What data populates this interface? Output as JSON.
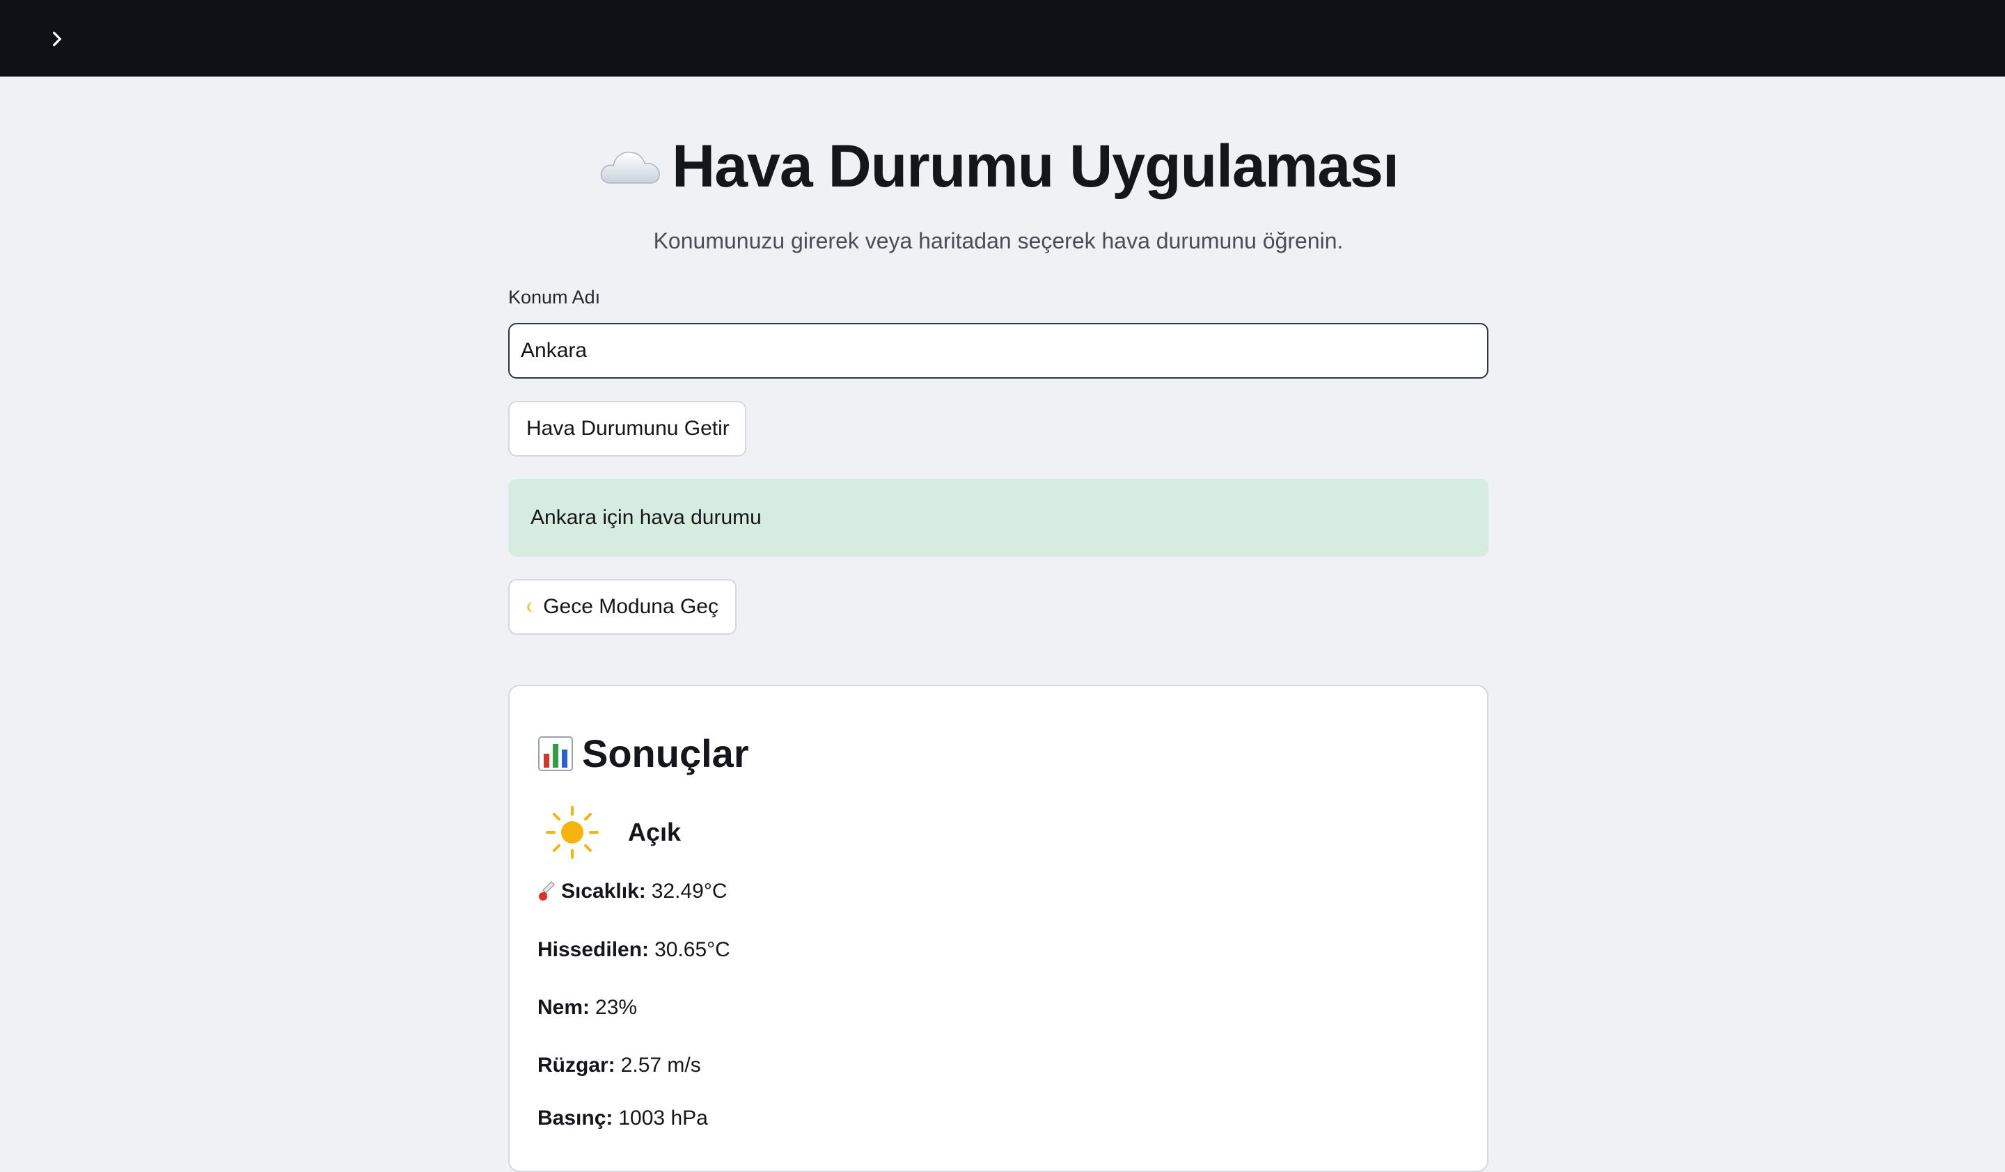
{
  "header": {
    "sidebar_toggle_icon": "chevron-right-icon"
  },
  "page": {
    "title_icon": "cloud-icon",
    "title": "Hava Durumu Uygulaması",
    "subtitle": "Konumunuzu girerek veya haritadan seçerek hava durumunu öğrenin."
  },
  "location_form": {
    "label": "Konum Adı",
    "value": "Ankara",
    "fetch_button_label": "Hava Durumunu Getir"
  },
  "alert": {
    "message": "Ankara için hava durumu"
  },
  "night_mode": {
    "icon": "crescent-moon-icon",
    "button_label": "Gece Moduna Geç"
  },
  "results": {
    "heading_icon": "bar-chart-icon",
    "heading": "Sonuçlar",
    "condition_icon": "sun-icon",
    "condition": "Açık",
    "metrics": [
      {
        "icon": "thermometer-icon",
        "label": "Sıcaklık:",
        "value": "32.49°C"
      },
      {
        "label": "Hissedilen:",
        "value": "30.65°C"
      },
      {
        "label": "Nem:",
        "value": "23%"
      },
      {
        "label": "Rüzgar:",
        "value": "2.57 m/s"
      },
      {
        "label": "Basınç:",
        "value": "1003 hPa"
      }
    ]
  },
  "colors": {
    "topbar": "#101117",
    "background": "#eff1f4",
    "success_alert": "#d6ece0"
  }
}
